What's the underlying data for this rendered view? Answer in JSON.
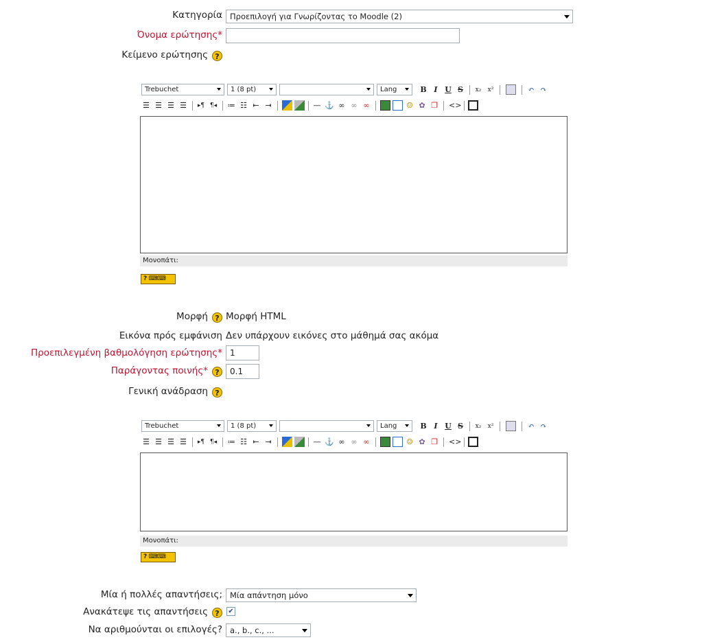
{
  "form": {
    "category": {
      "label": "Κατηγορία",
      "value": "Προεπιλογή για Γνωρίζοντας το Moodle (2)"
    },
    "question_name": {
      "label": "Όνομα ερώτησης",
      "required_mark": "*",
      "value": ""
    },
    "question_text": {
      "label": "Κείμενο ερώτησης"
    },
    "format": {
      "label": "Μορφή",
      "value": "Μορφή HTML"
    },
    "image": {
      "label": "Εικόνα πρός εμφάνιση",
      "value": "Δεν υπάρχουν εικόνες στο μάθημά σας ακόμα"
    },
    "default_grade": {
      "label": "Προεπιλεγμένη βαθμολόγηση ερώτησης",
      "required_mark": "*",
      "value": "1"
    },
    "penalty": {
      "label": "Παράγοντας ποινής",
      "required_mark": "*",
      "value": "0.1"
    },
    "general_feedback": {
      "label": "Γενική ανάδραση"
    },
    "single": {
      "label": "Μία ή πολλές απαντήσεις;",
      "value": "Μία απάντηση μόνο"
    },
    "shuffle": {
      "label": "Ανακάτεψε τις απαντήσεις",
      "checked": true
    },
    "numbering": {
      "label": "Να αριθμούνται οι επιλογές?",
      "value": "a., b., c., ..."
    }
  },
  "editor": {
    "font_family": "Trebuchet",
    "font_size": "1 (8 pt)",
    "heading": "",
    "lang": "Lang",
    "bold": "B",
    "italic": "I",
    "underline": "U",
    "strike": "S",
    "subscript": "x₂",
    "superscript": "x²",
    "path_label": "Μονοπάτι:",
    "help_symbol": "?"
  },
  "colors": {
    "required": "#c8102e",
    "help_icon": "#f3c200",
    "path_bar": "#ebebeb"
  }
}
